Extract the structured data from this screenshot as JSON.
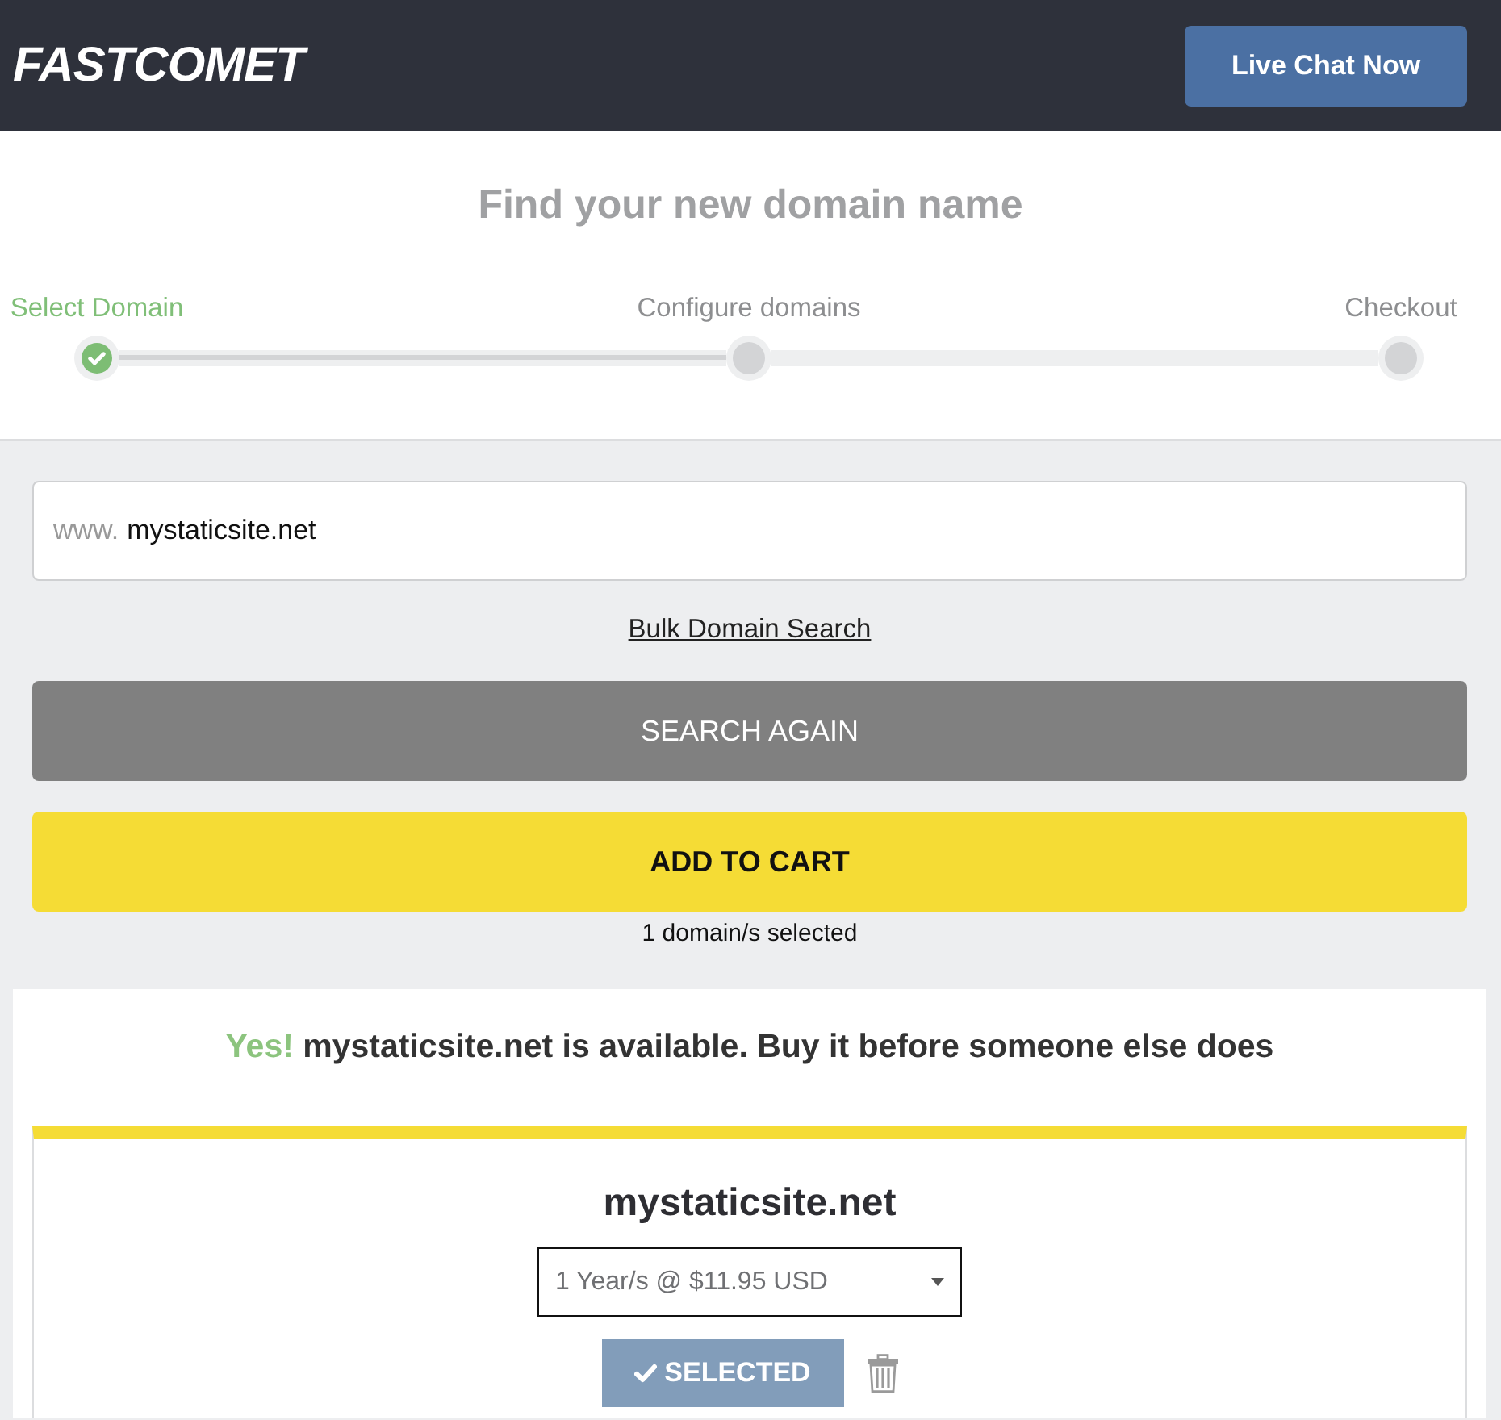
{
  "header": {
    "logo": "FASTCOMET",
    "chat_button": "Live Chat Now"
  },
  "title": "Find your new domain name",
  "steps": [
    {
      "label": "Select Domain",
      "completed": true
    },
    {
      "label": "Configure domains",
      "completed": false
    },
    {
      "label": "Checkout",
      "completed": false
    }
  ],
  "search": {
    "prefix": "www.",
    "value": "mystaticsite.net",
    "bulk_link": "Bulk Domain Search",
    "search_button": "SEARCH AGAIN",
    "cart_button": "ADD TO CART",
    "selection_count": "1 domain/s selected"
  },
  "availability": {
    "highlight": "Yes!",
    "message": "mystaticsite.net is available. Buy it before someone else does"
  },
  "result": {
    "domain": "mystaticsite.net",
    "period": "1 Year/s @ $11.95 USD",
    "selected": true,
    "select_button": "SELECTED"
  }
}
